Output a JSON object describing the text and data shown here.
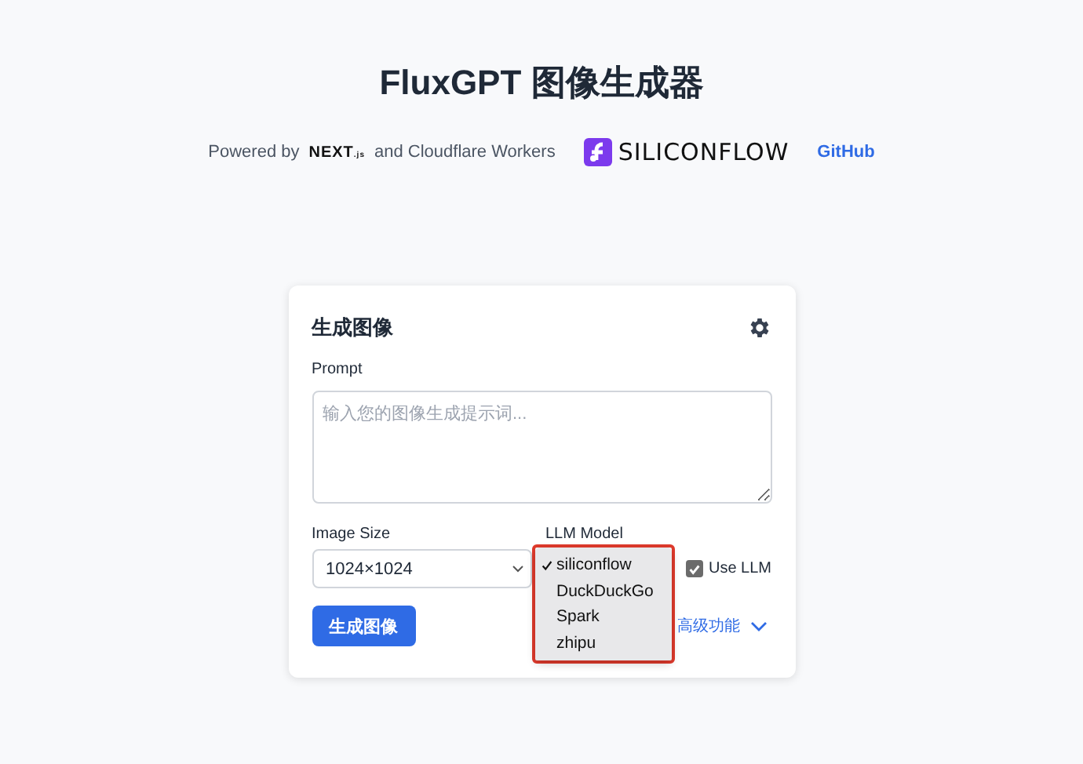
{
  "header": {
    "title": "FluxGPT 图像生成器",
    "powered_by": "Powered by",
    "nextjs_logo": {
      "main": "NEXT",
      "suffix": ".js"
    },
    "and_text": "and Cloudflare Workers",
    "siliconflow_logo": "SILICONFLOW",
    "github_link": "GitHub"
  },
  "card": {
    "title": "生成图像",
    "prompt_label": "Prompt",
    "prompt_placeholder": "输入您的图像生成提示词...",
    "image_size": {
      "label": "Image Size",
      "value": "1024×1024"
    },
    "llm_model": {
      "label": "LLM Model",
      "options": [
        {
          "label": "siliconflow",
          "selected": true
        },
        {
          "label": "DuckDuckGo",
          "selected": false
        },
        {
          "label": "Spark",
          "selected": false
        },
        {
          "label": "zhipu",
          "selected": false
        }
      ]
    },
    "use_llm": {
      "label": "Use LLM",
      "checked": true
    },
    "generate_button": "生成图像",
    "advanced_toggle": {
      "label": "高级功能",
      "expanded": false
    }
  }
}
